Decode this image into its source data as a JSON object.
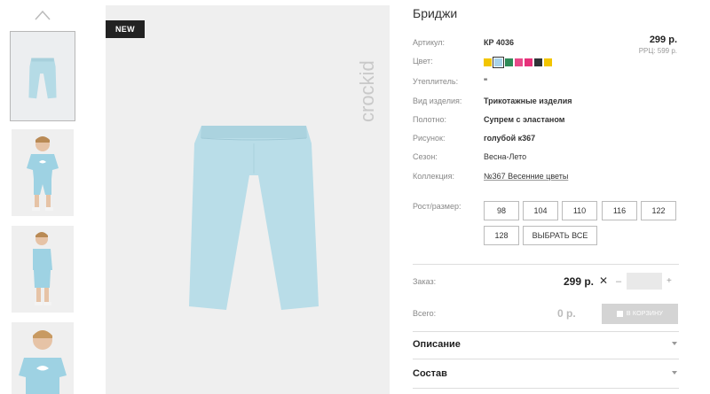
{
  "product": {
    "badge": "NEW",
    "brand": "crockid",
    "title": "Бриджи",
    "price": "299 р.",
    "rrp": "РРЦ: 599 р."
  },
  "attributes": [
    {
      "label": "Артикул:",
      "value": "КР 4036"
    },
    {
      "label": "Цвет:",
      "value": ""
    },
    {
      "label": "Утеплитель:",
      "value": "\""
    },
    {
      "label": "Вид изделия:",
      "value": "Трикотажные изделия"
    },
    {
      "label": "Полотно:",
      "value": "Супрем с эластаном"
    },
    {
      "label": "Рисунок:",
      "value": "голубой к367"
    },
    {
      "label": "Сезон:",
      "value": "Весна-Лето"
    },
    {
      "label": "Коллекция:",
      "value": "№367 Весенние цветы"
    }
  ],
  "colors": [
    "#f2c500",
    "#a9d3ea",
    "#2e8b57",
    "#e84a8a",
    "#e6317a",
    "#2f3437",
    "#f2c500"
  ],
  "sizes": {
    "label": "Рост/размер:",
    "options": [
      "98",
      "104",
      "110",
      "116",
      "122",
      "128"
    ],
    "select_all": "ВЫБРАТЬ ВСЕ"
  },
  "order": {
    "label": "Заказ:",
    "price": "299 р.",
    "times": "✕",
    "minus": "–",
    "plus": "+",
    "qty": ""
  },
  "total": {
    "label": "Всего:",
    "value": "0 р.",
    "cart_button": "В КОРЗИНУ"
  },
  "accordions": [
    {
      "title": "Описание"
    },
    {
      "title": "Состав"
    }
  ],
  "icons": {
    "thumbs_up": "chevron-up-icon",
    "cart": "cart-icon",
    "accordion": "chevron-down-icon"
  }
}
